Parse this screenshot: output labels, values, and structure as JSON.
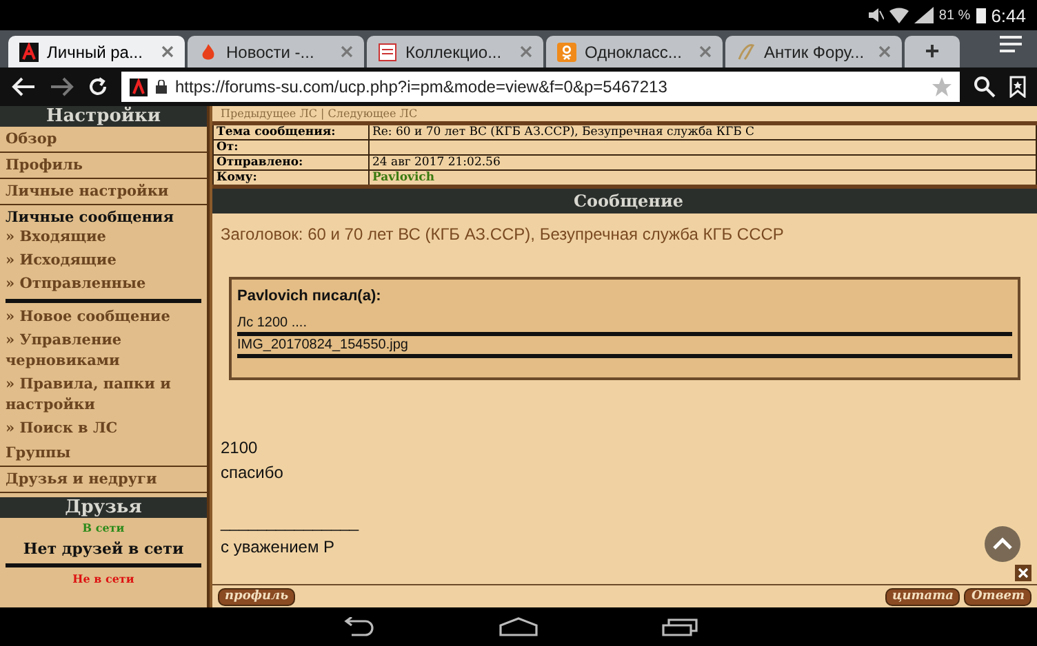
{
  "status_bar": {
    "battery": "81 %",
    "time": "6:44"
  },
  "tabs": [
    {
      "label": "Личный ра...",
      "selected": true
    },
    {
      "label": "Новости -...",
      "selected": false
    },
    {
      "label": "Коллекцио...",
      "selected": false
    },
    {
      "label": "Однокласс...",
      "selected": false
    },
    {
      "label": "Антик Фору...",
      "selected": false
    }
  ],
  "new_tab": "+",
  "address_bar": {
    "url": "https://forums-su.com/ucp.php?i=pm&mode=view&f=0&p=5467213"
  },
  "sidebar": {
    "title": "Настройки",
    "items": [
      {
        "label": "Обзор",
        "kind": "item"
      },
      {
        "label": "Профиль",
        "kind": "item"
      },
      {
        "label": "Личные настройки",
        "kind": "item"
      },
      {
        "label": "Личные сообщения",
        "kind": "section"
      },
      {
        "label": "» Входящие",
        "kind": "sub"
      },
      {
        "label": "» Исходящие",
        "kind": "sub"
      },
      {
        "label": "» Отправленные",
        "kind": "sub"
      },
      {
        "kind": "rule"
      },
      {
        "label": "» Новое сообщение",
        "kind": "sub"
      },
      {
        "label": "» Управление черновиками",
        "kind": "sub"
      },
      {
        "label": "» Правила, папки и настройки",
        "kind": "sub"
      },
      {
        "label": "» Поиск в ЛС",
        "kind": "sub"
      },
      {
        "label": "Группы",
        "kind": "item"
      },
      {
        "label": "Друзья и недруги",
        "kind": "item"
      }
    ],
    "friends": {
      "title": "Друзья",
      "online_label": "В сети",
      "online_text": "Нет друзей в сети",
      "offline_label": "Не в сети"
    }
  },
  "message": {
    "nav": "Предыдущее ЛС | Следующее ЛС",
    "fields": [
      {
        "label": "Тема сообщения:",
        "value": "Re: 60 и 70 лет ВС (КГБ АЗ.ССР), Безупречная служба КГБ С"
      },
      {
        "label": "От:"
      },
      {
        "label": "Отправлено:",
        "value": "24 авг 2017 21:02.56"
      },
      {
        "label": "Кому:",
        "value": "Pavlovich"
      }
    ],
    "header": "Сообщение",
    "subject": "Заголовок: 60 и 70 лет ВС (КГБ АЗ.ССР), Безупречная служба КГБ СССР",
    "quote": {
      "author": "Pavlovich писал(а):",
      "lines": [
        "Лс 1200 ....",
        "IMG_20170824_154550.jpg"
      ]
    },
    "body": [
      "2100",
      "спасибо"
    ],
    "signature_rule": "_______________",
    "signature": "с уважением Р",
    "buttons": {
      "profile": "профиль",
      "quote": "цитата",
      "reply": "Ответ"
    }
  }
}
